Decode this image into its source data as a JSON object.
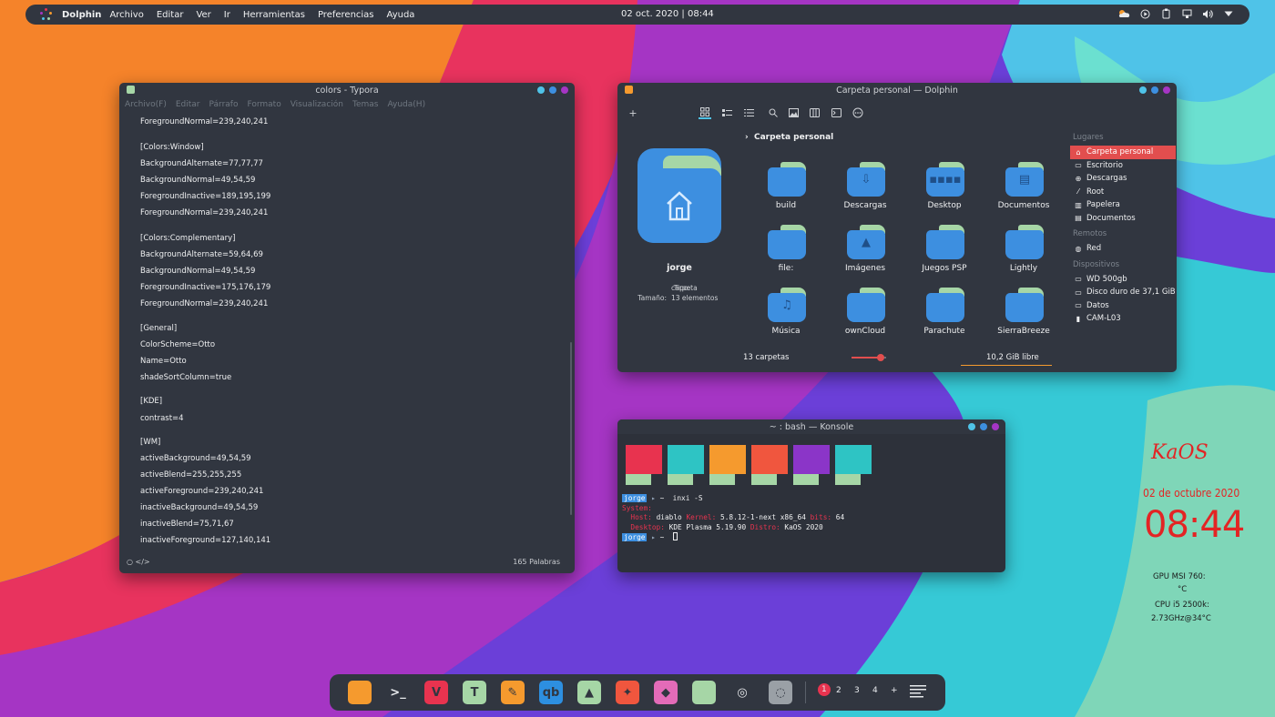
{
  "panel": {
    "app_name": "Dolphin",
    "menus": [
      "Archivo",
      "Editar",
      "Ver",
      "Ir",
      "Herramientas",
      "Preferencias",
      "Ayuda"
    ],
    "clock": "02 oct. 2020 | 08:44",
    "tray_icons": [
      "weather-icon",
      "media-play-icon",
      "clipboard-icon",
      "network-icon",
      "volume-icon",
      "chevron-down-icon"
    ]
  },
  "typora": {
    "title": "colors - Typora",
    "menus": [
      "Archivo(F)",
      "Editar",
      "Párrafo",
      "Formato",
      "Visualización",
      "Temas",
      "Ayuda(H)"
    ],
    "lines": [
      "ForegroundNormal=239,240,241",
      "[Colors:Window]",
      "BackgroundAlternate=77,77,77",
      "BackgroundNormal=49,54,59",
      "ForegroundInactive=189,195,199",
      "ForegroundNormal=239,240,241",
      "[Colors:Complementary]",
      "BackgroundAlternate=59,64,69",
      "BackgroundNormal=49,54,59",
      "ForegroundInactive=175,176,179",
      "ForegroundNormal=239,240,241",
      "[General]",
      "ColorScheme=Otto",
      "Name=Otto",
      "shadeSortColumn=true",
      "[KDE]",
      "contrast=4",
      "[WM]",
      "activeBackground=49,54,59",
      "activeBlend=255,255,255",
      "activeForeground=239,240,241",
      "inactiveBackground=49,54,59",
      "inactiveBlend=75,71,67",
      "inactiveForeground=127,140,141"
    ],
    "footer_left": "○   </>",
    "word_count": "165 Palabras"
  },
  "dolphin": {
    "title": "Carpeta personal — Dolphin",
    "breadcrumb": "Carpeta personal",
    "info": {
      "name": "jorge",
      "type_label": "Tipo:",
      "type_value": "carpeta",
      "size_label": "Tamaño:",
      "size_value": "13 elementos"
    },
    "folders": [
      {
        "name": "build",
        "glyph": ""
      },
      {
        "name": "Descargas",
        "glyph": "⇩"
      },
      {
        "name": "Desktop",
        "glyph": "▪▪▪▪"
      },
      {
        "name": "Documentos",
        "glyph": "▤"
      },
      {
        "name": "file:",
        "glyph": ""
      },
      {
        "name": "Imágenes",
        "glyph": "▲"
      },
      {
        "name": "Juegos PSP",
        "glyph": ""
      },
      {
        "name": "Lightly",
        "glyph": ""
      },
      {
        "name": "Música",
        "glyph": "♫"
      },
      {
        "name": "ownCloud",
        "glyph": ""
      },
      {
        "name": "Parachute",
        "glyph": ""
      },
      {
        "name": "SierraBreeze",
        "glyph": ""
      }
    ],
    "places": {
      "lugares_title": "Lugares",
      "lugares": [
        {
          "label": "Carpeta personal",
          "icon": "home-icon",
          "glyph": "⌂"
        },
        {
          "label": "Escritorio",
          "icon": "desktop-icon",
          "glyph": "▭"
        },
        {
          "label": "Descargas",
          "icon": "download-icon",
          "glyph": "⊕"
        },
        {
          "label": "Root",
          "icon": "root-icon",
          "glyph": "⁄"
        },
        {
          "label": "Papelera",
          "icon": "trash-icon",
          "glyph": "▥"
        },
        {
          "label": "Documentos",
          "icon": "documents-icon",
          "glyph": "▤"
        }
      ],
      "remotos_title": "Remotos",
      "remotos": [
        {
          "label": "Red",
          "icon": "network-icon",
          "glyph": "◍"
        }
      ],
      "dispositivos_title": "Dispositivos",
      "dispositivos": [
        {
          "label": "WD 500gb",
          "icon": "drive-icon",
          "glyph": "▭"
        },
        {
          "label": "Disco duro de 37,1 GiB",
          "icon": "drive-icon",
          "glyph": "▭"
        },
        {
          "label": "Datos",
          "icon": "drive-icon",
          "glyph": "▭"
        },
        {
          "label": "CAM-L03",
          "icon": "phone-icon",
          "glyph": "▮"
        }
      ]
    },
    "status_count": "13 carpetas",
    "status_free": "10,2 GiB libre",
    "zoom_fraction": 0.85
  },
  "konsole": {
    "title": "~ : bash — Konsole",
    "swatch_colors": [
      "#e8334f",
      "#2ec4c4",
      "#f59a2e",
      "#f0563e",
      "#8b35c8",
      "#2ec4c4"
    ],
    "prompt_user": "jorge",
    "prompt_path": "~",
    "command": "inxi -S",
    "system_label": "System:",
    "host_label": "Host:",
    "host_value": "diablo",
    "kernel_label": "Kernel:",
    "kernel_value": "5.8.12-1-next x86_64",
    "bits_label": "bits:",
    "bits_value": "64",
    "desktop_label": "Desktop:",
    "desktop_value": "KDE Plasma 5.19.90",
    "distro_label": "Distro:",
    "distro_value": "KaOS 2020"
  },
  "clock_widget": {
    "brand": "KaOS",
    "date": "02 de octubre 2020",
    "time": "08:44",
    "cpu_line1": "GPU MSI 760:",
    "cpu_line2": "°C",
    "cpu_line3": "CPU i5 2500k:",
    "cpu_line4": "2.73GHz@34°C"
  },
  "dock": {
    "apps": [
      {
        "name": "dolphin-app-icon",
        "color": "#f59a2e",
        "glyph": ""
      },
      {
        "name": "konsole-app-icon",
        "color": "#313640",
        "glyph": ">_"
      },
      {
        "name": "vivaldi-app-icon",
        "color": "#e8334f",
        "glyph": "V"
      },
      {
        "name": "typora-app-icon",
        "color": "#a6d6a6",
        "glyph": "T"
      },
      {
        "name": "kate-app-icon",
        "color": "#f59a2e",
        "glyph": "✎"
      },
      {
        "name": "qbittorrent-app-icon",
        "color": "#2d8fe0",
        "glyph": "qb"
      },
      {
        "name": "inkscape-app-icon",
        "color": "#a6d6a6",
        "glyph": "▲"
      },
      {
        "name": "krita-app-icon",
        "color": "#f0563e",
        "glyph": "✦"
      },
      {
        "name": "color-picker-app-icon",
        "color": "#e36bb8",
        "glyph": "◆"
      },
      {
        "name": "notes-app-icon",
        "color": "#a6d6a6",
        "glyph": ""
      },
      {
        "name": "steam-app-icon",
        "color": "#313640",
        "glyph": "◎"
      },
      {
        "name": "settings-app-icon",
        "color": "#9aa0a6",
        "glyph": "◌"
      }
    ],
    "pager": [
      "1",
      "2",
      "3",
      "4",
      "+"
    ],
    "accent": "#e8334f"
  }
}
